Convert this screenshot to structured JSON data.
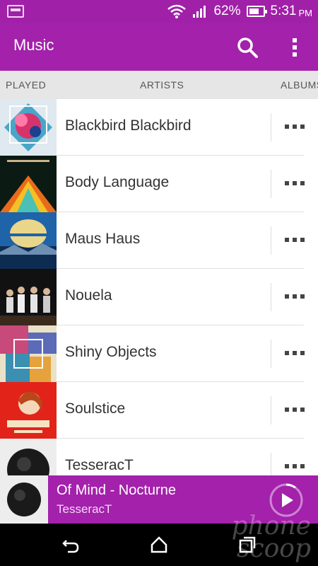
{
  "status": {
    "battery_percent": "62%",
    "time": "5:31",
    "ampm": "PM"
  },
  "appbar": {
    "title": "Music",
    "icons": [
      "search-icon",
      "more-vert-icon"
    ]
  },
  "tabs": [
    {
      "label": "PLAYED"
    },
    {
      "label": "ARTISTS"
    },
    {
      "label": "ALBUMS"
    }
  ],
  "artists": [
    {
      "name": "Blackbird Blackbird"
    },
    {
      "name": "Body Language"
    },
    {
      "name": "Maus Haus"
    },
    {
      "name": "Nouela"
    },
    {
      "name": "Shiny Objects"
    },
    {
      "name": "Soulstice"
    },
    {
      "name": "TesseracT"
    }
  ],
  "now_playing": {
    "title": "Of Mind - Nocturne",
    "artist": "TesseracT",
    "progress": 0.1
  },
  "watermark": {
    "line1": "phone",
    "line2": "scoop"
  },
  "colors": {
    "accent": "#a321ab",
    "statusbar": "#a020a8"
  }
}
